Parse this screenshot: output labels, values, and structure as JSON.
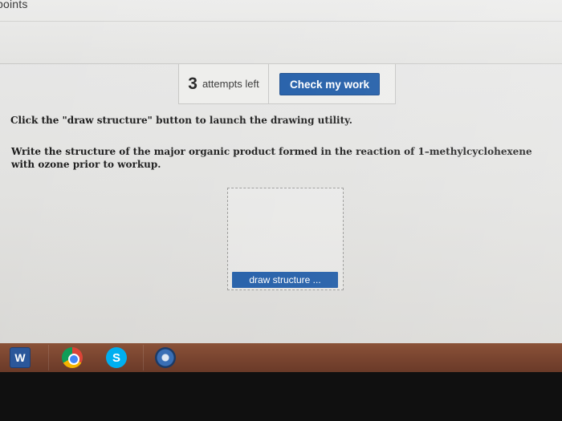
{
  "header": {
    "points_prefix": "",
    "points_label": "points"
  },
  "attempts": {
    "count": "3",
    "label": "attempts left"
  },
  "check_button": {
    "label": "Check my work"
  },
  "instruction": "Click the \"draw structure\" button to launch the drawing utility.",
  "question": "Write the structure of the major organic product formed in the reaction of 1–methylcyclohexene with ozone prior to workup.",
  "drawing": {
    "button_label": "draw structure ..."
  },
  "taskbar": {
    "word_icon_letter": "W",
    "skype_icon_letter": "S",
    "colors": {
      "taskbar": "#7a4530",
      "accent_button": "#1d5aa6"
    }
  }
}
